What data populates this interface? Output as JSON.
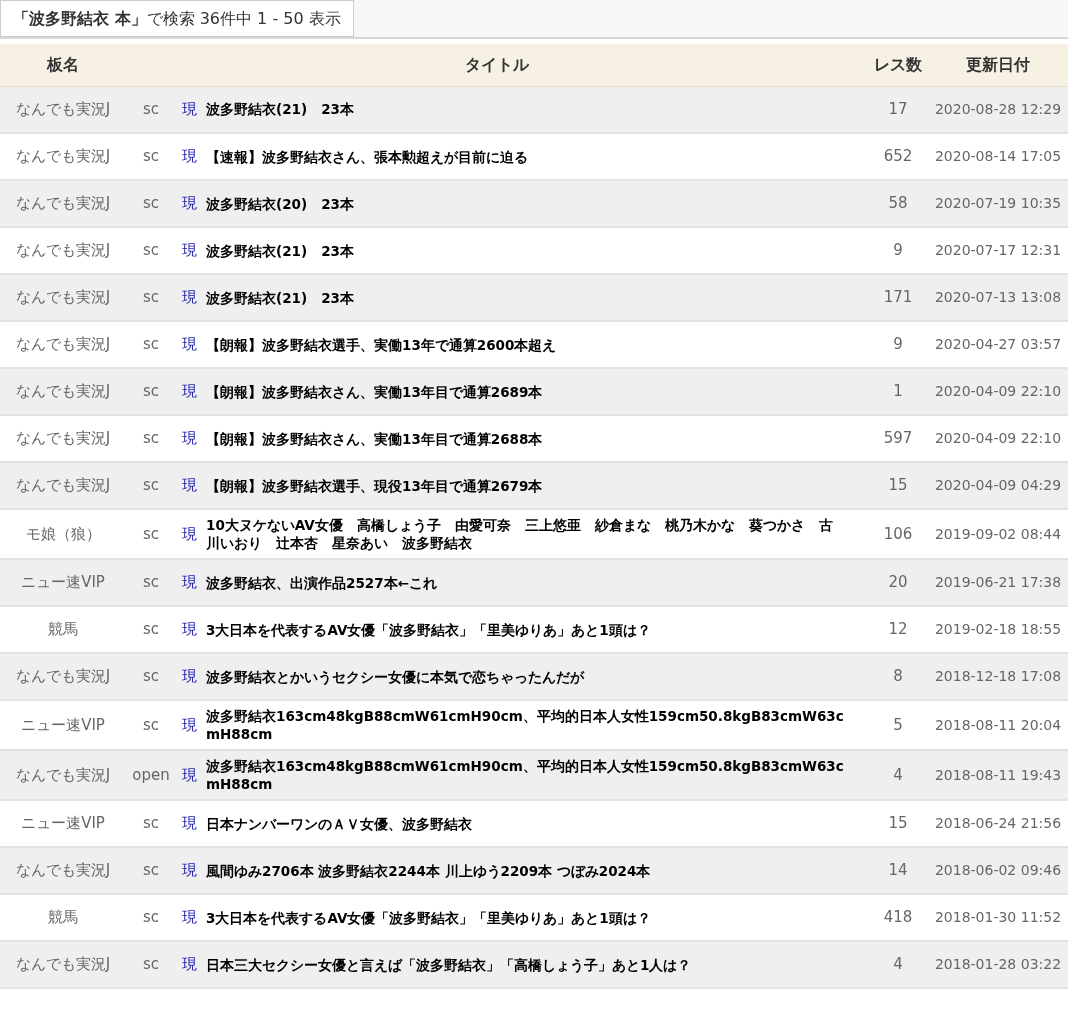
{
  "search_summary": "**「波多野結衣 本」**で検索 36件中 1 - 50 表示",
  "table": {
    "columns": [
      "板名",
      "タイトル",
      "レス数",
      "更新日付"
    ],
    "rows": [
      {
        "board": "なんでも実況J",
        "server": "sc",
        "link": "現",
        "title": "波多野結衣(21)　23本",
        "res": "17",
        "date": "2020-08-28 12:29"
      },
      {
        "board": "なんでも実況J",
        "server": "sc",
        "link": "現",
        "title": "【速報】波多野結衣さん、張本勲超えが目前に迫る",
        "res": "652",
        "date": "2020-08-14 17:05"
      },
      {
        "board": "なんでも実況J",
        "server": "sc",
        "link": "現",
        "title": "波多野結衣(20)　23本",
        "res": "58",
        "date": "2020-07-19 10:35"
      },
      {
        "board": "なんでも実況J",
        "server": "sc",
        "link": "現",
        "title": "波多野結衣(21)　23本",
        "res": "9",
        "date": "2020-07-17 12:31"
      },
      {
        "board": "なんでも実況J",
        "server": "sc",
        "link": "現",
        "title": "波多野結衣(21)　23本",
        "res": "171",
        "date": "2020-07-13 13:08"
      },
      {
        "board": "なんでも実況J",
        "server": "sc",
        "link": "現",
        "title": "【朗報】波多野結衣選手、実働13年で通算2600本超え",
        "res": "9",
        "date": "2020-04-27 03:57"
      },
      {
        "board": "なんでも実況J",
        "server": "sc",
        "link": "現",
        "title": "【朗報】波多野結衣さん、実働13年目で通算2689本",
        "res": "1",
        "date": "2020-04-09 22:10"
      },
      {
        "board": "なんでも実況J",
        "server": "sc",
        "link": "現",
        "title": "【朗報】波多野結衣さん、実働13年目で通算2688本",
        "res": "597",
        "date": "2020-04-09 22:10"
      },
      {
        "board": "なんでも実況J",
        "server": "sc",
        "link": "現",
        "title": "【朗報】波多野結衣選手、現役13年目で通算2679本",
        "res": "15",
        "date": "2020-04-09 04:29"
      },
      {
        "board": "モ娘（狼）",
        "server": "sc",
        "link": "現",
        "title": "10大ヌケないAV女優　高橋しょう子　由愛可奈　三上悠亜　紗倉まな　桃乃木かな　葵つかさ　古川いおり　辻本杏　星奈あい　波多野結衣",
        "res": "106",
        "date": "2019-09-02 08:44"
      },
      {
        "board": "ニュー速VIP",
        "server": "sc",
        "link": "現",
        "title": "波多野結衣、出演作品2527本←これ",
        "res": "20",
        "date": "2019-06-21 17:38"
      },
      {
        "board": "競馬",
        "server": "sc",
        "link": "現",
        "title": "3大日本を代表するAV女優「波多野結衣」「里美ゆりあ」あと1頭は？",
        "res": "12",
        "date": "2019-02-18 18:55"
      },
      {
        "board": "なんでも実況J",
        "server": "sc",
        "link": "現",
        "title": "波多野結衣とかいうセクシー女優に本気で恋ちゃったんだが",
        "res": "8",
        "date": "2018-12-18 17:08"
      },
      {
        "board": "ニュー速VIP",
        "server": "sc",
        "link": "現",
        "title": "波多野結衣163cm48kgB88cmW61cmH90cm、平均的日本人女性159cm50.8kgB83cmW63cmH88cm",
        "res": "5",
        "date": "2018-08-11 20:04"
      },
      {
        "board": "なんでも実況J",
        "server": "open",
        "link": "現",
        "title": "波多野結衣163cm48kgB88cmW61cmH90cm、平均的日本人女性159cm50.8kgB83cmW63cmH88cm",
        "res": "4",
        "date": "2018-08-11 19:43"
      },
      {
        "board": "ニュー速VIP",
        "server": "sc",
        "link": "現",
        "title": "日本ナンバーワンのＡＶ女優、波多野結衣",
        "res": "15",
        "date": "2018-06-24 21:56"
      },
      {
        "board": "なんでも実況J",
        "server": "sc",
        "link": "現",
        "title": "風間ゆみ2706本 波多野結衣2244本 川上ゆう2209本 つぼみ2024本",
        "res": "14",
        "date": "2018-06-02 09:46"
      },
      {
        "board": "競馬",
        "server": "sc",
        "link": "現",
        "title": "3大日本を代表するAV女優「波多野結衣」「里美ゆりあ」あと1頭は？",
        "res": "418",
        "date": "2018-01-30 11:52"
      },
      {
        "board": "なんでも実況J",
        "server": "sc",
        "link": "現",
        "title": "日本三大セクシー女優と言えば「波多野結衣」「高橋しょう子」あと1人は？",
        "res": "4",
        "date": "2018-01-28 03:22"
      }
    ]
  }
}
